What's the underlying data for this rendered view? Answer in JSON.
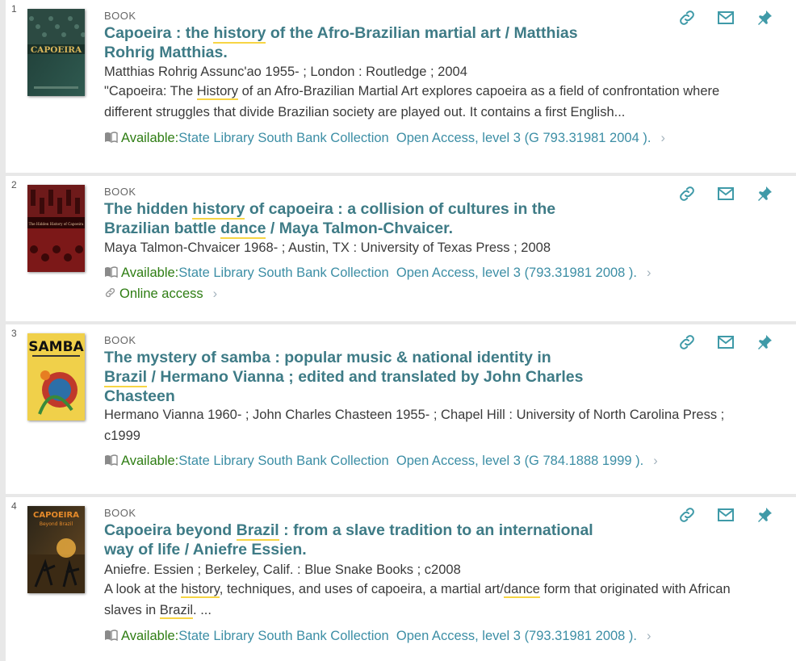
{
  "colors": {
    "title": "#3e7b86",
    "available": "#2e7d13",
    "location": "#3c8ea5",
    "icon": "#3f9aa8",
    "highlight": "#f7d544"
  },
  "results": [
    {
      "num": "1",
      "type": "BOOK",
      "title": [
        {
          "t": "Capoeira : the "
        },
        {
          "t": "history",
          "hl": true
        },
        {
          "t": " of the Afro-Brazilian martial art / Matthias Rohrig Matthias."
        }
      ],
      "author_line": "Matthias Rohrig Assunc'ao 1955- ; London : Routledge ; 2004",
      "description": [
        {
          "t": "\"Capoeira: The "
        },
        {
          "t": "History",
          "hl": true
        },
        {
          "t": " of an Afro-Brazilian Martial Art explores capoeira as a field of confrontation where different struggles that divide Brazilian society are played out. It contains a first English..."
        }
      ],
      "available_label": "Available:",
      "location": "State Library South Bank Collection  Open Access, level 3 (G 793.31981 2004 ).",
      "online": "",
      "cover_text": "CAPOEIRA"
    },
    {
      "num": "2",
      "type": "BOOK",
      "title": [
        {
          "t": "The hidden "
        },
        {
          "t": "history",
          "hl": true
        },
        {
          "t": " of capoeira : a collision of cultures in the Brazilian battle "
        },
        {
          "t": "dance",
          "hl": true
        },
        {
          "t": " / Maya Talmon-Chvaicer."
        }
      ],
      "author_line": "Maya Talmon-Chvaicer 1968- ; Austin, TX : University of Texas Press ; 2008",
      "description": [],
      "available_label": "Available:",
      "location": "State Library South Bank Collection  Open Access, level 3 (793.31981 2008 ).",
      "online": "Online access",
      "cover_text": "The Hidden History of Capoeira"
    },
    {
      "num": "3",
      "type": "BOOK",
      "title": [
        {
          "t": "The mystery of samba : popular music & national identity in "
        },
        {
          "t": "Brazil",
          "hl": true
        },
        {
          "t": " / Hermano Vianna ; edited and translated by John Charles Chasteen"
        }
      ],
      "author_line": "Hermano Vianna 1960- ; John Charles Chasteen 1955- ; Chapel Hill : University of North Carolina Press ; c1999",
      "description": [],
      "available_label": "Available:",
      "location": "State Library South Bank Collection  Open Access, level 3 (G 784.1888 1999 ).",
      "online": "",
      "cover_text": "SAMBA"
    },
    {
      "num": "4",
      "type": "BOOK",
      "title": [
        {
          "t": "Capoeira beyond "
        },
        {
          "t": "Brazil",
          "hl": true
        },
        {
          "t": " : from a slave tradition to an international way of life / Aniefre Essien."
        }
      ],
      "author_line": "Aniefre. Essien ; Berkeley, Calif. : Blue Snake Books ; c2008",
      "description": [
        {
          "t": "A look at the "
        },
        {
          "t": "history",
          "hl": true
        },
        {
          "t": ", techniques, and uses of capoeira, a martial art/"
        },
        {
          "t": "dance",
          "hl": true
        },
        {
          "t": " form that originated with African slaves in "
        },
        {
          "t": "Brazil",
          "hl": true
        },
        {
          "t": ". ..."
        }
      ],
      "available_label": "Available:",
      "location": "State Library South Bank Collection  Open Access, level 3 (793.31981 2008 ).",
      "online": "",
      "cover_text": "CAPOEIRA"
    }
  ],
  "icons": [
    "link-icon",
    "email-icon",
    "pin-icon",
    "more-icon"
  ]
}
